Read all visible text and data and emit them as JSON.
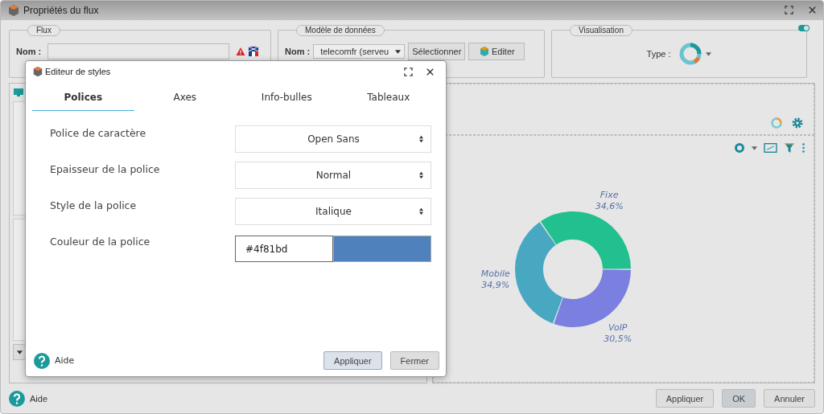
{
  "window": {
    "title": "Propriétés du flux"
  },
  "flux_group": {
    "legend": "Flux",
    "name_label": "Nom :"
  },
  "data_model_group": {
    "legend": "Modèle de données",
    "name_label": "Nom :",
    "model_select": "telecomfr (serveu",
    "select_button": "Sélectionner",
    "edit_button": "Editer"
  },
  "visualisation_group": {
    "legend": "Visualisation",
    "type_label": "Type :",
    "toggle_on": true
  },
  "chart_panel": {
    "chart_data": {
      "type": "donut",
      "categories": [
        "Fixe",
        "VoIP",
        "Mobile"
      ],
      "values": [
        34.6,
        30.5,
        34.9
      ],
      "colors": [
        "#22c08f",
        "#7a7fe0",
        "#48a8c2"
      ],
      "value_labels": [
        "34,6%",
        "30,5%",
        "34,9%"
      ]
    }
  },
  "style_editor": {
    "title": "Editeur de styles",
    "tabs": [
      {
        "label": "Polices",
        "selected": true
      },
      {
        "label": "Axes",
        "selected": false
      },
      {
        "label": "Info-bulles",
        "selected": false
      },
      {
        "label": "Tableaux",
        "selected": false
      }
    ],
    "fields": [
      {
        "kind": "select",
        "label": "Police de caractère",
        "value": "Open Sans"
      },
      {
        "kind": "select",
        "label": "Epaisseur de la police",
        "value": "Normal"
      },
      {
        "kind": "select",
        "label": "Style de la police",
        "value": "Italique"
      },
      {
        "kind": "color",
        "label": "Couleur de la police",
        "value": "#4f81bd"
      }
    ],
    "help": "Aide",
    "buttons": [
      {
        "label": "Appliquer",
        "focused": true
      },
      {
        "label": "Fermer",
        "focused": false
      }
    ]
  },
  "footer": {
    "help": "Aide",
    "buttons": [
      {
        "label": "Appliquer",
        "selected": false
      },
      {
        "label": "OK",
        "selected": true
      },
      {
        "label": "Annuler",
        "selected": false
      }
    ]
  }
}
